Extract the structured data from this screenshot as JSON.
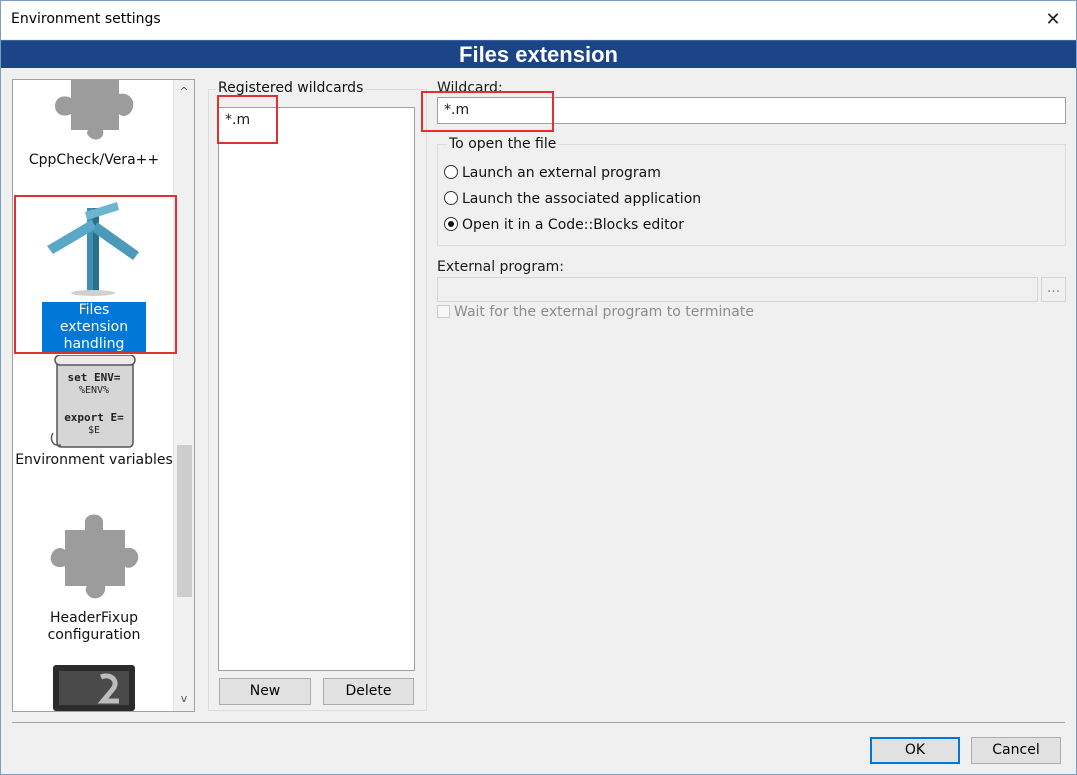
{
  "window": {
    "title": "Environment settings",
    "close_glyph": "✕"
  },
  "header": {
    "title": "Files extension"
  },
  "categories": [
    {
      "label": "CppCheck/Vera++",
      "icon": "puzzle-icon",
      "selected": false
    },
    {
      "label": "Files extension handling",
      "icon": "signpost-icon",
      "selected": true
    },
    {
      "label": "Environment variables",
      "icon": "scroll-icon",
      "selected": false,
      "icon_text": [
        "set ENV=",
        "%ENV%",
        "export E=",
        "$E"
      ]
    },
    {
      "label": "HeaderFixup configuration",
      "icon": "puzzle-icon",
      "selected": false
    },
    {
      "label": "",
      "icon": "monitor-icon",
      "selected": false
    }
  ],
  "scrollbar": {
    "up": "^",
    "down": "v"
  },
  "wildcards": {
    "caption": "Registered wildcards",
    "items": [
      "*.m"
    ],
    "new_label": "New",
    "delete_label": "Delete"
  },
  "wildcard_field": {
    "label": "Wildcard:",
    "value": "*.m"
  },
  "open_group": {
    "caption": "To open the file",
    "options": [
      {
        "label": "Launch an external program",
        "checked": false
      },
      {
        "label": "Launch the associated application",
        "checked": false
      },
      {
        "label": "Open it in a Code::Blocks editor",
        "checked": true
      }
    ]
  },
  "external_program": {
    "label": "External program:",
    "value": "",
    "browse_label": "...",
    "wait_label": "Wait for the external program to terminate"
  },
  "footer": {
    "ok_label": "OK",
    "cancel_label": "Cancel"
  },
  "colors": {
    "header_bg": "#1c4587",
    "selection": "#0078d7",
    "highlight": "#e03030"
  }
}
